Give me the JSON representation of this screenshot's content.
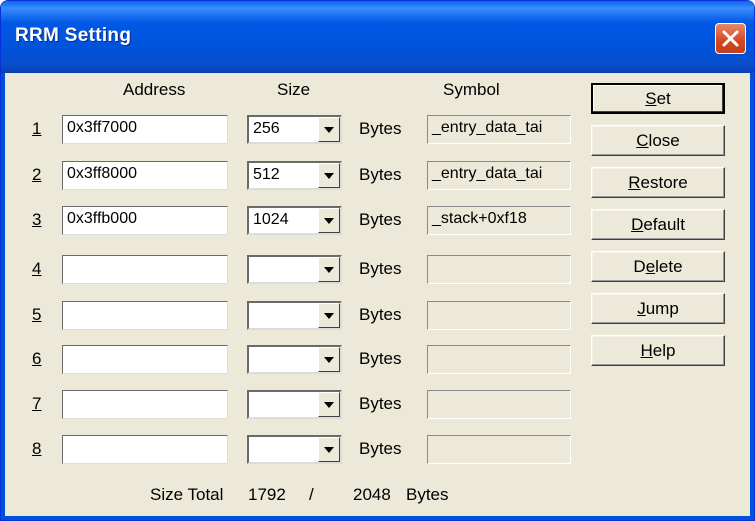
{
  "window": {
    "title": "RRM Setting"
  },
  "headers": {
    "address": "Address",
    "size": "Size",
    "symbol": "Symbol"
  },
  "rows": [
    {
      "num": "1",
      "address": "0x3ff7000",
      "size": "256",
      "unit": "Bytes",
      "symbol": "_entry_data_tai"
    },
    {
      "num": "2",
      "address": "0x3ff8000",
      "size": "512",
      "unit": "Bytes",
      "symbol": "_entry_data_tai"
    },
    {
      "num": "3",
      "address": "0x3ffb000",
      "size": "1024",
      "unit": "Bytes",
      "symbol": "_stack+0xf18"
    },
    {
      "num": "4",
      "address": "",
      "size": "",
      "unit": "Bytes",
      "symbol": ""
    },
    {
      "num": "5",
      "address": "",
      "size": "",
      "unit": "Bytes",
      "symbol": ""
    },
    {
      "num": "6",
      "address": "",
      "size": "",
      "unit": "Bytes",
      "symbol": ""
    },
    {
      "num": "7",
      "address": "",
      "size": "",
      "unit": "Bytes",
      "symbol": ""
    },
    {
      "num": "8",
      "address": "",
      "size": "",
      "unit": "Bytes",
      "symbol": ""
    }
  ],
  "buttons": [
    {
      "mn": "S",
      "rest": "et",
      "pre": ""
    },
    {
      "mn": "C",
      "rest": "lose",
      "pre": ""
    },
    {
      "mn": "R",
      "rest": "estore",
      "pre": ""
    },
    {
      "mn": "D",
      "rest": "efault",
      "pre": ""
    },
    {
      "pre": "D",
      "mn": "e",
      "rest": "lete"
    },
    {
      "mn": "J",
      "rest": "ump",
      "pre": ""
    },
    {
      "mn": "H",
      "rest": "elp",
      "pre": ""
    }
  ],
  "footer": {
    "label": "Size Total",
    "used": "1792",
    "separator": "/",
    "total": "2048",
    "unit": "Bytes"
  }
}
